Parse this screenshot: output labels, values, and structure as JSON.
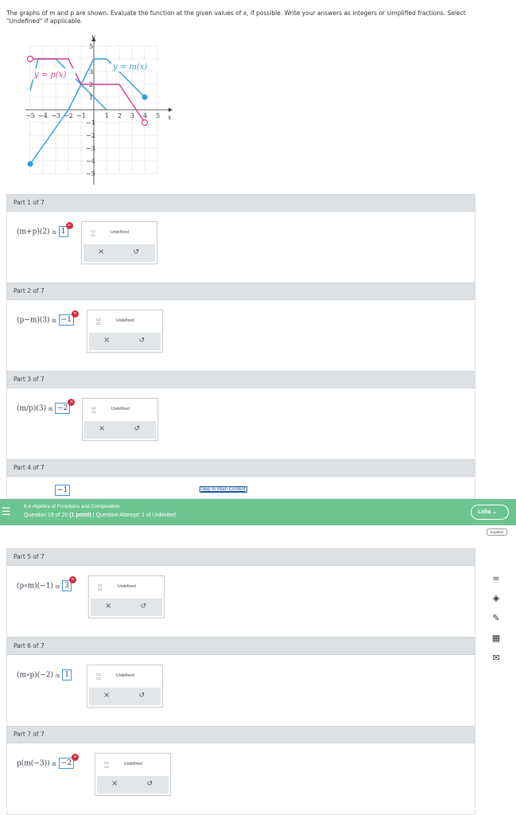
{
  "instructions": "The graphs of m and p are shown. Evaluate the function at the given values of x, if possible. Write your answers as integers or simplified fractions. Select \"Undefined\" if applicable.",
  "graph": {
    "y_axis_label": "y",
    "x_axis_label": "x",
    "m_label": "y = m(x)",
    "p_label": "y = p(x)",
    "x_ticks": [
      "−5",
      "−4",
      "−3",
      "−2",
      "−1",
      "1",
      "2",
      "3",
      "4",
      "5"
    ],
    "y_ticks": [
      "5",
      "3",
      "2",
      "1",
      "−1",
      "−2",
      "−3",
      "−4",
      "−5"
    ],
    "m_color": "#2a9fd6",
    "p_color": "#d93a8a"
  },
  "parts": [
    {
      "header": "Part 1 of 7",
      "expr": "(m+p)(2)",
      "is": "is",
      "answer": "1",
      "wrong": true
    },
    {
      "header": "Part 2 of 7",
      "expr": "(p−m)(3)",
      "is": "is",
      "answer": "−1",
      "wrong": true
    },
    {
      "header": "Part 3 of 7",
      "expr": "(m/p)(3)",
      "is": "is",
      "answer": "−2",
      "wrong": true
    },
    {
      "header": "Part 4 of 7",
      "expr": "",
      "is": "",
      "answer": "−1",
      "wrong": false
    },
    {
      "header": "Part 5 of 7",
      "expr": "(p∘m)(−1)",
      "is": "is",
      "answer": "3",
      "wrong": true
    },
    {
      "header": "Part 6 of 7",
      "expr": "(m∘p)(−2)",
      "is": "is",
      "answer": "1",
      "wrong": false
    },
    {
      "header": "Part 7 of 7",
      "expr": "p(m(−3))",
      "is": "is",
      "answer": "−2",
      "wrong": true
    }
  ],
  "palette": {
    "undefined_label": "Undefined",
    "clear_glyph": "×",
    "undo_glyph": "↺",
    "fraction_glyph": "□/□"
  },
  "banner": {
    "title": "6.4 Algebra of Functions and Composition",
    "question": "Question 19 of 20",
    "points": "(1 point)",
    "separator": "|",
    "attempt": "Question Attempt: 1 of Unlimited",
    "menu_icon": "hamburger-icon"
  },
  "user_name": "Lidia",
  "language_button": "Español",
  "skip_link": "Skip to Main Content",
  "side_icons": [
    "infinity-icon",
    "diamond-icon",
    "edit-doc-icon",
    "calculator-icon",
    "mail-icon"
  ]
}
